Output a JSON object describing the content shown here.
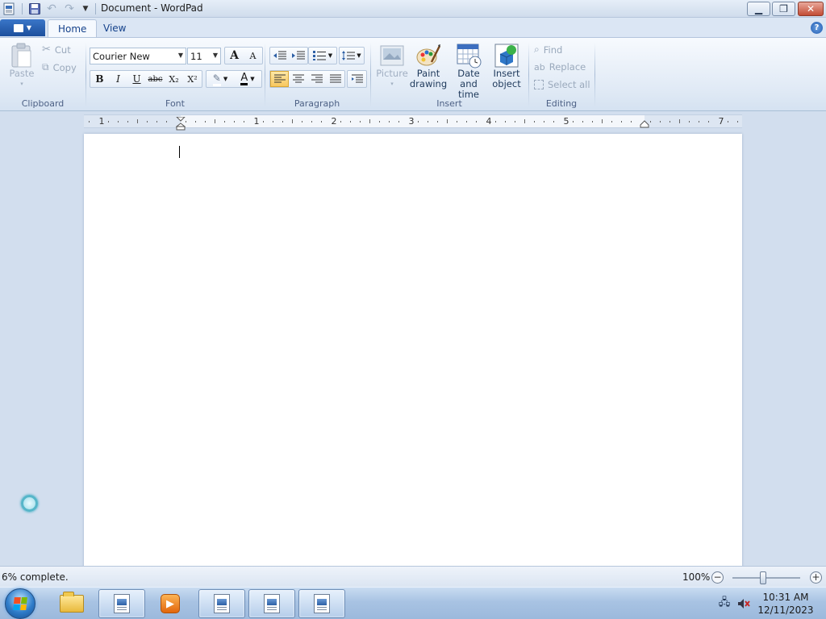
{
  "window": {
    "title": "Document - WordPad",
    "minimize_glyph": "▁",
    "maximize_glyph": "❐",
    "close_glyph": "✕"
  },
  "tabs": [
    {
      "label": "Home",
      "active": true
    },
    {
      "label": "View",
      "active": false
    }
  ],
  "help_glyph": "?",
  "ribbon": {
    "clipboard": {
      "label": "Clipboard",
      "paste": "Paste",
      "cut": "Cut",
      "copy": "Copy"
    },
    "font": {
      "label": "Font",
      "family": "Courier New",
      "size": "11",
      "bold": "B",
      "italic": "I",
      "underline": "U",
      "strikethrough": "abc",
      "subscript": "X₂",
      "superscript": "X²",
      "grow": "A",
      "shrink": "A"
    },
    "paragraph": {
      "label": "Paragraph"
    },
    "insert": {
      "label": "Insert",
      "picture": "Picture",
      "paint_1": "Paint",
      "paint_2": "drawing",
      "datetime_1": "Date and",
      "datetime_2": "time",
      "object_1": "Insert",
      "object_2": "object"
    },
    "editing": {
      "label": "Editing",
      "find": "Find",
      "replace": "Replace",
      "select_all": "Select all"
    }
  },
  "ruler": {
    "numbers": [
      "1",
      "1",
      "2",
      "3",
      "4",
      "5",
      "7"
    ]
  },
  "status": {
    "text": "6% complete.",
    "zoom": "100%",
    "zoom_out": "−",
    "zoom_in": "+",
    "zoom_fraction": 0.45
  },
  "taskbar": {
    "time": "10:31 AM",
    "date": "12/11/2023",
    "items": [
      "wordpad",
      "explorer",
      "wordpad",
      "media-player",
      "wordpad",
      "wordpad",
      "wordpad"
    ]
  },
  "colors": {
    "accent": "#1f5ab1",
    "active_button": "#f8c75f"
  }
}
